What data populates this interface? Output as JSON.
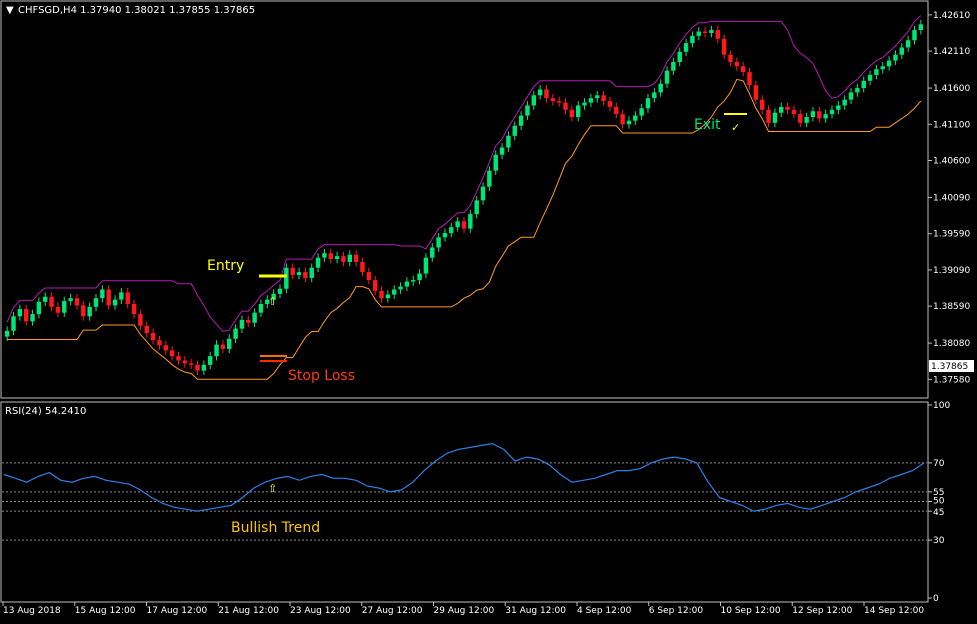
{
  "header": {
    "symbol_info": "CHFSGD,H4  1.37940 1.38021 1.37855 1.37865"
  },
  "colors": {
    "background": "#000000",
    "frame": "#c0c0c0",
    "bull": "#00e676",
    "bear": "#ff1a1a",
    "trail_orange": "#ff9a1f",
    "trail_magenta": "#d21fd2",
    "rsi_line": "#2f7fe6",
    "level_line": "#8a8a8a",
    "entry_text": "#ffff00",
    "stop_text": "#ff3b1f",
    "exit_text": "#00e676",
    "bullish_text": "#ffc400",
    "arrow": "#ffff00"
  },
  "main_chart": {
    "y_axis_labels": [
      "1.42610",
      "1.42110",
      "1.41600",
      "1.41100",
      "1.40600",
      "1.40090",
      "1.39590",
      "1.39090",
      "1.38590",
      "1.38080",
      "1.37580"
    ],
    "current_price": "1.37865",
    "annotations": {
      "entry": "Entry",
      "stop_loss": "Stop Loss",
      "exit": "Exit",
      "exit_check": "✓",
      "up_arrow": "⇧"
    }
  },
  "rsi_panel": {
    "title": "RSI(24) 54.2410",
    "scale_labels": [
      "100",
      "70",
      "55",
      "50",
      "45",
      "30",
      "0"
    ],
    "annotation": "Bullish Trend",
    "up_arrow": "⇧"
  },
  "x_axis": {
    "labels": [
      "13 Aug 2018",
      "15 Aug 12:00",
      "17 Aug 12:00",
      "21 Aug 12:00",
      "23 Aug 12:00",
      "27 Aug 12:00",
      "29 Aug 12:00",
      "31 Aug 12:00",
      "4 Sep 12:00",
      "6 Sep 12:00",
      "10 Sep 12:00",
      "12 Sep 12:00",
      "14 Sep 12:00"
    ]
  },
  "chart_data": {
    "type": "candlestick",
    "symbol": "CHFSGD",
    "timeframe": "H4",
    "ylim": [
      1.3735,
      1.4276
    ],
    "closes": [
      1.3825,
      1.3845,
      1.3855,
      1.3838,
      1.3848,
      1.3865,
      1.3872,
      1.3858,
      1.385,
      1.3866,
      1.387,
      1.386,
      1.3845,
      1.3858,
      1.387,
      1.3882,
      1.386,
      1.3868,
      1.3878,
      1.3862,
      1.3848,
      1.3832,
      1.3822,
      1.3812,
      1.3805,
      1.3798,
      1.379,
      1.3784,
      1.378,
      1.3778,
      1.377,
      1.3778,
      1.379,
      1.3806,
      1.38,
      1.3814,
      1.3828,
      1.384,
      1.3836,
      1.385,
      1.3862,
      1.3868,
      1.3876,
      1.3883,
      1.3912,
      1.3902,
      1.3906,
      1.3898,
      1.3912,
      1.3926,
      1.3932,
      1.3924,
      1.3928,
      1.392,
      1.393,
      1.392,
      1.3906,
      1.3895,
      1.388,
      1.387,
      1.3875,
      1.3882,
      1.3886,
      1.3893,
      1.3895,
      1.3904,
      1.3926,
      1.394,
      1.3954,
      1.396,
      1.3968,
      1.3976,
      1.3966,
      1.3986,
      1.4005,
      1.4024,
      1.4046,
      1.4068,
      1.4078,
      1.4094,
      1.4108,
      1.4122,
      1.4136,
      1.415,
      1.4158,
      1.4146,
      1.4142,
      1.414,
      1.413,
      1.412,
      1.4136,
      1.414,
      1.4146,
      1.415,
      1.4142,
      1.4134,
      1.4124,
      1.411,
      1.4115,
      1.4122,
      1.4132,
      1.4146,
      1.4154,
      1.4166,
      1.4184,
      1.4196,
      1.421,
      1.4222,
      1.4232,
      1.4238,
      1.4236,
      1.424,
      1.4228,
      1.4206,
      1.4196,
      1.419,
      1.4182,
      1.4164,
      1.4144,
      1.413,
      1.4112,
      1.4126,
      1.4134,
      1.413,
      1.4124,
      1.4112,
      1.412,
      1.4128,
      1.4118,
      1.4124,
      1.413,
      1.4136,
      1.4144,
      1.4154,
      1.416,
      1.417,
      1.4178,
      1.4186,
      1.419,
      1.4198,
      1.4206,
      1.4216,
      1.4226,
      1.424,
      1.4248
    ],
    "series": [
      {
        "name": "RSI(24)",
        "values": [
          64,
          62,
          60,
          63,
          65,
          61,
          60,
          62,
          63,
          61,
          60,
          59,
          56,
          52,
          49,
          47,
          46,
          45,
          46,
          47,
          48,
          52,
          57,
          60,
          62,
          63,
          61,
          63,
          64,
          62,
          62,
          61,
          58,
          57,
          55,
          56,
          60,
          66,
          71,
          75,
          77,
          78,
          79,
          80,
          77,
          71,
          73,
          72,
          69,
          64,
          60,
          61,
          62,
          64,
          66,
          66,
          67,
          70,
          72,
          73,
          72,
          70,
          60,
          52,
          50,
          48,
          45,
          46,
          48,
          49,
          47,
          46,
          48,
          50,
          52,
          55,
          57,
          59,
          62,
          64,
          66,
          70
        ]
      }
    ],
    "levels": [
      70,
      55,
      50,
      45,
      30
    ],
    "rsi_ylim": [
      0,
      100
    ]
  }
}
